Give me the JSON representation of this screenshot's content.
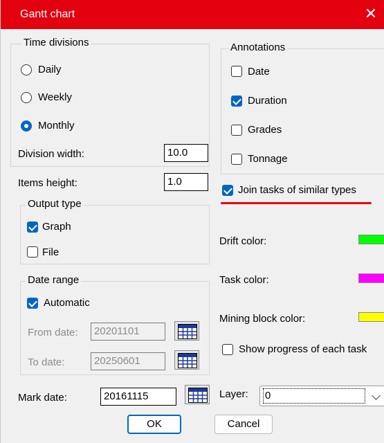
{
  "dialog": {
    "title": "Gantt chart",
    "close_glyph": "✕"
  },
  "time_divisions": {
    "legend": "Time divisions",
    "options": [
      {
        "label": "Daily",
        "selected": false
      },
      {
        "label": "Weekly",
        "selected": false
      },
      {
        "label": "Monthly",
        "selected": true
      }
    ],
    "division_width_label": "Division width:",
    "division_width_value": "10.0"
  },
  "items_height": {
    "label": "Items height:",
    "value": "1.0"
  },
  "output_type": {
    "legend": "Output type",
    "graph": {
      "label": "Graph",
      "checked": true
    },
    "file": {
      "label": "File",
      "checked": false
    }
  },
  "date_range": {
    "legend": "Date range",
    "automatic": {
      "label": "Automatic",
      "checked": true
    },
    "from_label": "From date:",
    "from_value": "20201101",
    "to_label": "To date:",
    "to_value": "20250601"
  },
  "mark_date": {
    "label": "Mark date:",
    "value": "20161115"
  },
  "annotations": {
    "legend": "Annotations",
    "date": {
      "label": "Date",
      "checked": false
    },
    "duration": {
      "label": "Duration",
      "checked": true
    },
    "grades": {
      "label": "Grades",
      "checked": false
    },
    "tonnage": {
      "label": "Tonnage",
      "checked": false
    }
  },
  "join_tasks": {
    "label": "Join tasks of similar types",
    "checked": true
  },
  "colors": {
    "drift_label": "Drift color:",
    "drift": "#00ff00",
    "task_label": "Task color:",
    "task": "#ff00ff",
    "mining_block_label": "Mining block color:",
    "mining_block": "#ffff00",
    "accent": "#0067c0",
    "title_bar": "#e3000f"
  },
  "show_progress": {
    "label": "Show progress of each task",
    "checked": false
  },
  "layer": {
    "label": "Layer:",
    "value": "0"
  },
  "buttons": {
    "ok": "OK",
    "cancel": "Cancel"
  },
  "icons": {
    "calendar": "calendar-icon",
    "close": "close-icon",
    "dropdown": "chevron-down-icon"
  }
}
